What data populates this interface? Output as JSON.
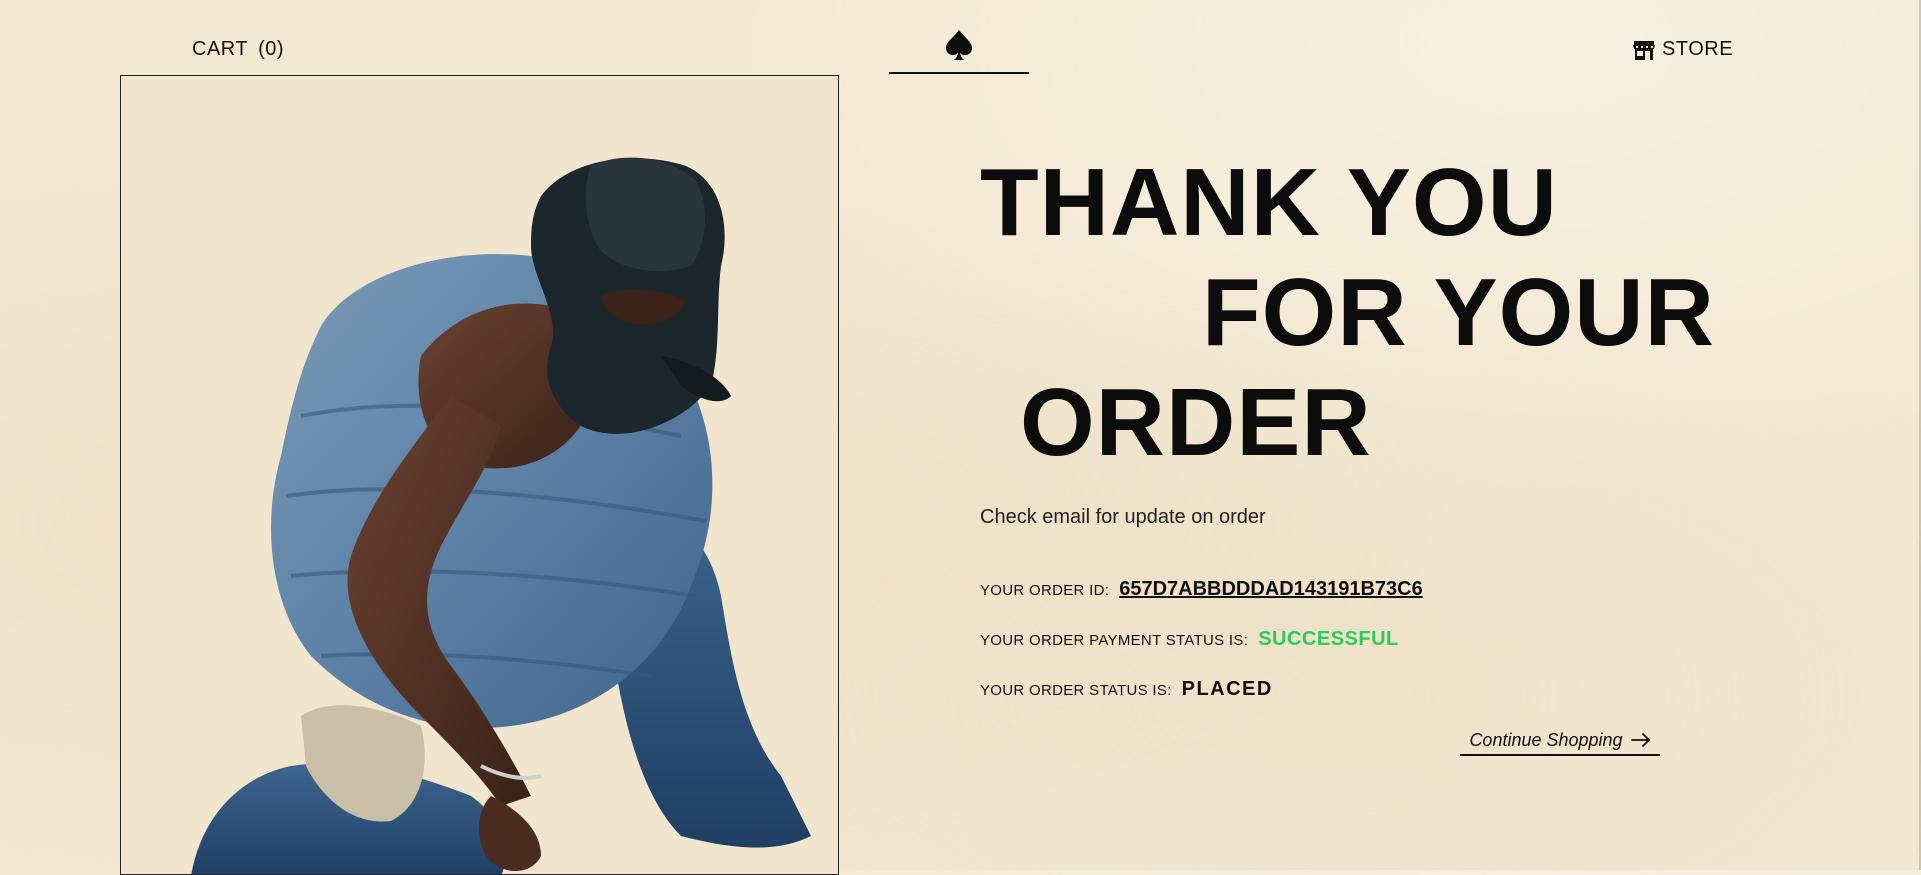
{
  "header": {
    "cart_label": "CART",
    "cart_count": "(0)",
    "logo_icon": "spade-icon",
    "store_icon": "store-icon",
    "store_label": "STORE"
  },
  "hero": {
    "image": "model-in-denim-puffer-photo"
  },
  "confirmation": {
    "headline_line1": "THANK YOU",
    "headline_line2": "FOR YOUR",
    "headline_line3": "ORDER",
    "note": "Check email for update on order",
    "order_id_label": "YOUR ORDER ID:",
    "order_id": "657D7ABBDDDAD143191B73C6",
    "payment_label": "YOUR ORDER PAYMENT STATUS IS:",
    "payment_status": "SUCCESSFUL",
    "order_status_label": "YOUR ORDER STATUS IS:",
    "order_status": "PLACED",
    "continue_label": "Continue Shopping",
    "continue_icon": "arrow-right-icon"
  },
  "colors": {
    "background": "#f3e8d2",
    "text": "#111111",
    "success": "#2ec95c"
  }
}
